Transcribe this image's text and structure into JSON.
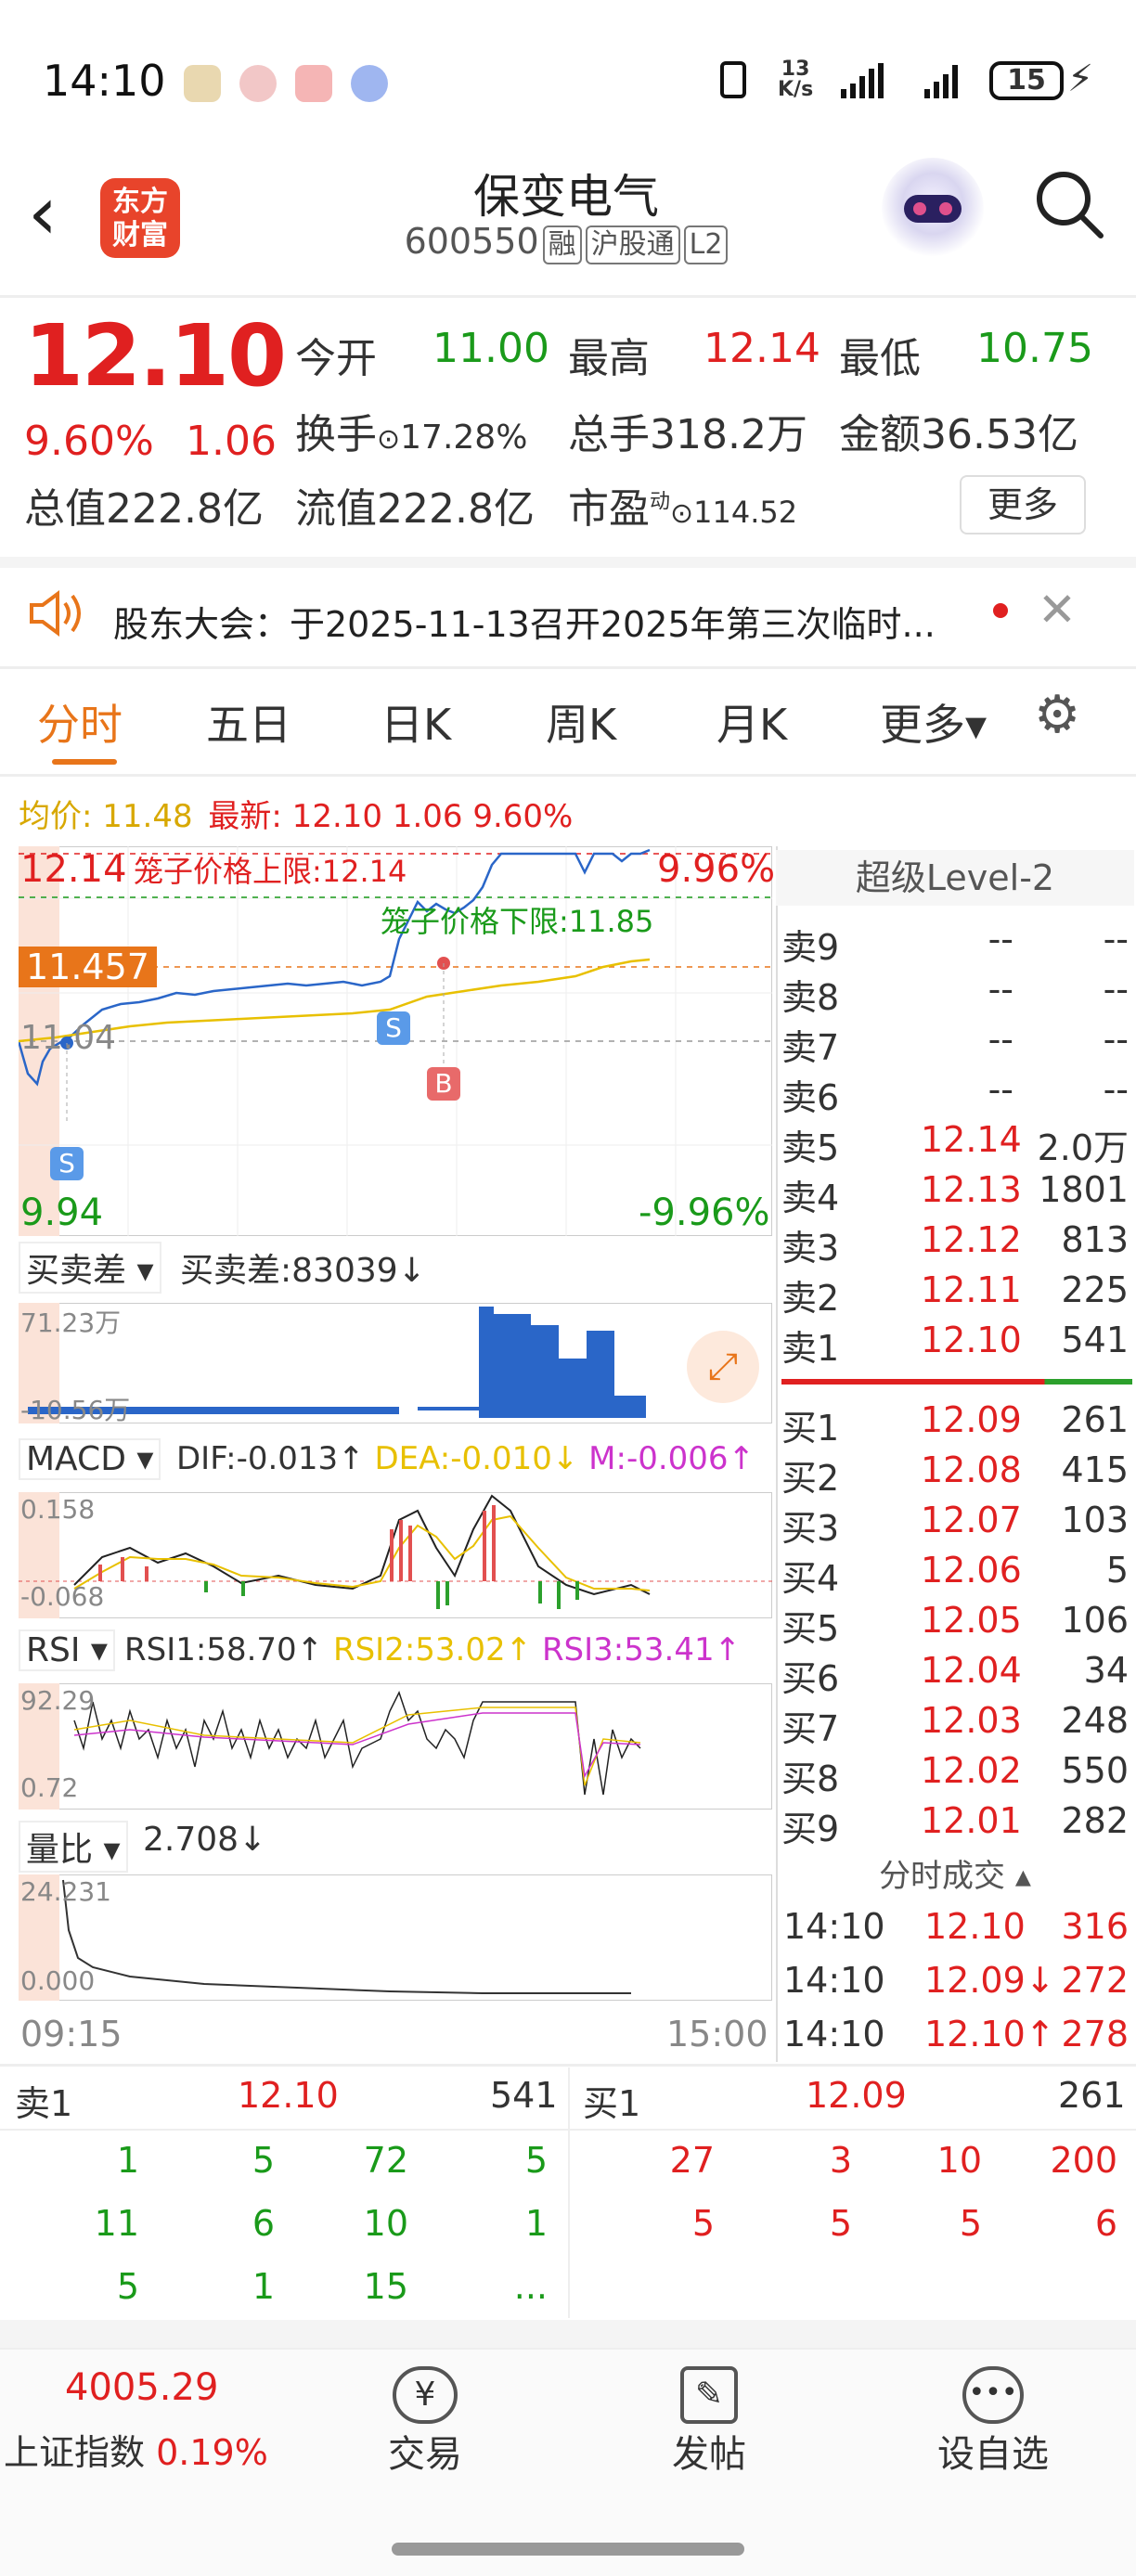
{
  "status_bar": {
    "time": "14:10",
    "net_speed_top": "13",
    "net_speed_bottom": "K/s",
    "battery": "15"
  },
  "header": {
    "logo_line1": "东方",
    "logo_line2": "财富",
    "title": "保变电气",
    "code": "600550",
    "tags": [
      "融",
      "沪股通",
      "L2"
    ]
  },
  "quote": {
    "price": "12.10",
    "change_pct": "9.60%",
    "change": "1.06",
    "open_label": "今开",
    "open": "11.00",
    "high_label": "最高",
    "high": "12.14",
    "low_label": "最低",
    "low": "10.75",
    "turnover_label": "换手",
    "turnover": "17.28%",
    "volume_label": "总手",
    "volume": "318.2万",
    "amount_label": "金额",
    "amount": "36.53亿",
    "mcap_label": "总值",
    "mcap": "222.8亿",
    "float_label": "流值",
    "float_cap": "222.8亿",
    "pe_label": "市盈",
    "pe_sup": "动",
    "pe": "114.52",
    "more_btn": "更多"
  },
  "notice": {
    "text": "股东大会：于2025-11-13召开2025年第三次临时..."
  },
  "tabs": {
    "items": [
      "分时",
      "五日",
      "日K",
      "周K",
      "月K",
      "更多▾"
    ],
    "active": 0
  },
  "intraday": {
    "avg_label": "均价: 11.48",
    "latest_label": "最新: 12.10 1.06 9.60%",
    "top_price": "12.14",
    "top_pct": "9.96%",
    "upper_limit": "笼子价格上限:12.14",
    "lower_limit": "笼子价格下限:11.85",
    "mid_tag": "11.457",
    "prev_close": "11.04",
    "bottom_price": "9.94",
    "bottom_pct": "-9.96%",
    "sell_marker": "S",
    "buy_marker": "B",
    "time_start": "09:15",
    "time_end": "15:00"
  },
  "indicators": {
    "spread_sel": "买卖差",
    "spread_val": "买卖差:83039↓",
    "spread_max": "71.23万",
    "spread_min": "-10.56万",
    "macd_sel": "MACD",
    "dif": "DIF:-0.013↑",
    "dea": "DEA:-0.010↓",
    "m": "M:-0.006↑",
    "macd_max": "0.158",
    "macd_min": "-0.068",
    "rsi_sel": "RSI",
    "rsi1": "RSI1:58.70↑",
    "rsi2": "RSI2:53.02↑",
    "rsi3": "RSI3:53.41↑",
    "rsi_max": "92.29",
    "rsi_min": "0.72",
    "vr_sel": "量比",
    "vr_val": "2.708↓",
    "vr_max": "24.231",
    "vr_min": "0.000"
  },
  "level2": {
    "title": "超级Level-2",
    "asks": [
      {
        "l": "卖9",
        "p": "--",
        "v": "--"
      },
      {
        "l": "卖8",
        "p": "--",
        "v": "--"
      },
      {
        "l": "卖7",
        "p": "--",
        "v": "--"
      },
      {
        "l": "卖6",
        "p": "--",
        "v": "--"
      },
      {
        "l": "卖5",
        "p": "12.14",
        "v": "2.0万"
      },
      {
        "l": "卖4",
        "p": "12.13",
        "v": "1801"
      },
      {
        "l": "卖3",
        "p": "12.12",
        "v": "813"
      },
      {
        "l": "卖2",
        "p": "12.11",
        "v": "225"
      },
      {
        "l": "卖1",
        "p": "12.10",
        "v": "541"
      }
    ],
    "bids": [
      {
        "l": "买1",
        "p": "12.09",
        "v": "261"
      },
      {
        "l": "买2",
        "p": "12.08",
        "v": "415"
      },
      {
        "l": "买3",
        "p": "12.07",
        "v": "103"
      },
      {
        "l": "买4",
        "p": "12.06",
        "v": "5"
      },
      {
        "l": "买5",
        "p": "12.05",
        "v": "106"
      },
      {
        "l": "买6",
        "p": "12.04",
        "v": "34"
      },
      {
        "l": "买7",
        "p": "12.03",
        "v": "248"
      },
      {
        "l": "买8",
        "p": "12.02",
        "v": "550"
      },
      {
        "l": "买9",
        "p": "12.01",
        "v": "282"
      }
    ],
    "ticks_title": "分时成交 ▴",
    "ticks": [
      {
        "t": "14:10",
        "p": "12.10",
        "v": "316"
      },
      {
        "t": "14:10",
        "p": "12.09↓",
        "v": "272"
      },
      {
        "t": "14:10",
        "p": "12.10↑",
        "v": "278"
      }
    ]
  },
  "queue": {
    "ask_label": "卖1",
    "ask_price": "12.10",
    "ask_total": "541",
    "bid_label": "买1",
    "bid_price": "12.09",
    "bid_total": "261",
    "ask_rows": [
      [
        "1",
        "5",
        "72",
        "5"
      ],
      [
        "11",
        "6",
        "10",
        "1"
      ],
      [
        "5",
        "1",
        "15",
        "..."
      ]
    ],
    "bid_rows": [
      [
        "27",
        "3",
        "10",
        "200"
      ],
      [
        "5",
        "5",
        "5",
        "6"
      ]
    ]
  },
  "bottom_bar": {
    "index_value": "4005.29",
    "index_name": "上证指数",
    "index_pct": "0.19%",
    "trade": "交易",
    "post": "发帖",
    "watch": "设自选"
  }
}
